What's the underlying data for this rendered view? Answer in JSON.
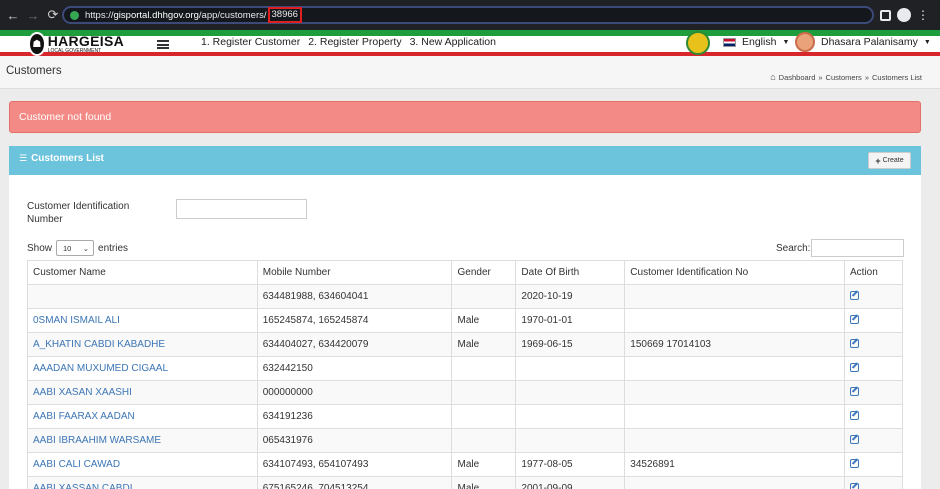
{
  "browser": {
    "back_icon": "←",
    "forward_icon": "→",
    "reload_icon": "⟳",
    "url_prefix": "https://",
    "url_host": "gisportal.dhhgov.org",
    "url_path": "/app/customers/",
    "url_id": "38966",
    "menu_icon": "⋮"
  },
  "header": {
    "logo_mark": "☗",
    "logo_title": "HARGEISA",
    "logo_subtitle": "LOCAL GOVERNMENT",
    "menu": [
      "1. Register Customer",
      "2. Register Property",
      "3. New Application"
    ],
    "language": "English",
    "caret": "▼",
    "user_name": "Dhasara Palanisamy"
  },
  "page": {
    "title": "Customers",
    "home_icon": "⌂",
    "breadcrumb": [
      "Dashboard",
      "Customers",
      "Customers List"
    ],
    "breadcrumb_sep": "»",
    "alert": "Customer not found"
  },
  "card": {
    "list_icon": "☰",
    "title": "Customers List",
    "plus_icon": "+",
    "create_label": "Create",
    "filter_label": "Customer Identification Number",
    "filter_value": "",
    "show_label": "Show",
    "entries_value": "10",
    "select_caret": "⌄",
    "entries_label": "entries",
    "search_label": "Search:",
    "search_value": ""
  },
  "table": {
    "columns": [
      "Customer Name",
      "Mobile Number",
      "Gender",
      "Date Of Birth",
      "Customer Identification No",
      "Action"
    ],
    "rows": [
      {
        "name": "",
        "mobile": "634481988, 634604041",
        "gender": "",
        "dob": "2020-10-19",
        "id_no": ""
      },
      {
        "name": "0SMAN ISMAIL ALI",
        "mobile": "165245874, 165245874",
        "gender": "Male",
        "dob": "1970-01-01",
        "id_no": ""
      },
      {
        "name": "A_KHATIN CABDI KABADHE",
        "mobile": "634404027, 634420079",
        "gender": "Male",
        "dob": "1969-06-15",
        "id_no": "150669 17014103"
      },
      {
        "name": "AAADAN MUXUMED CIGAAL",
        "mobile": "632442150",
        "gender": "",
        "dob": "",
        "id_no": ""
      },
      {
        "name": "AABI XASAN XAASHI",
        "mobile": "000000000",
        "gender": "",
        "dob": "",
        "id_no": ""
      },
      {
        "name": "AABI FAARAX AADAN",
        "mobile": "634191236",
        "gender": "",
        "dob": "",
        "id_no": ""
      },
      {
        "name": "AABI IBRAAHIM WARSAME",
        "mobile": "065431976",
        "gender": "",
        "dob": "",
        "id_no": ""
      },
      {
        "name": "AABI CALI CAWAD",
        "mobile": "634107493, 654107493",
        "gender": "Male",
        "dob": "1977-08-05",
        "id_no": "34526891"
      },
      {
        "name": "AABI XASSAN CABDI",
        "mobile": "675165246, 704513254",
        "gender": "Male",
        "dob": "2001-09-09",
        "id_no": ""
      }
    ]
  }
}
